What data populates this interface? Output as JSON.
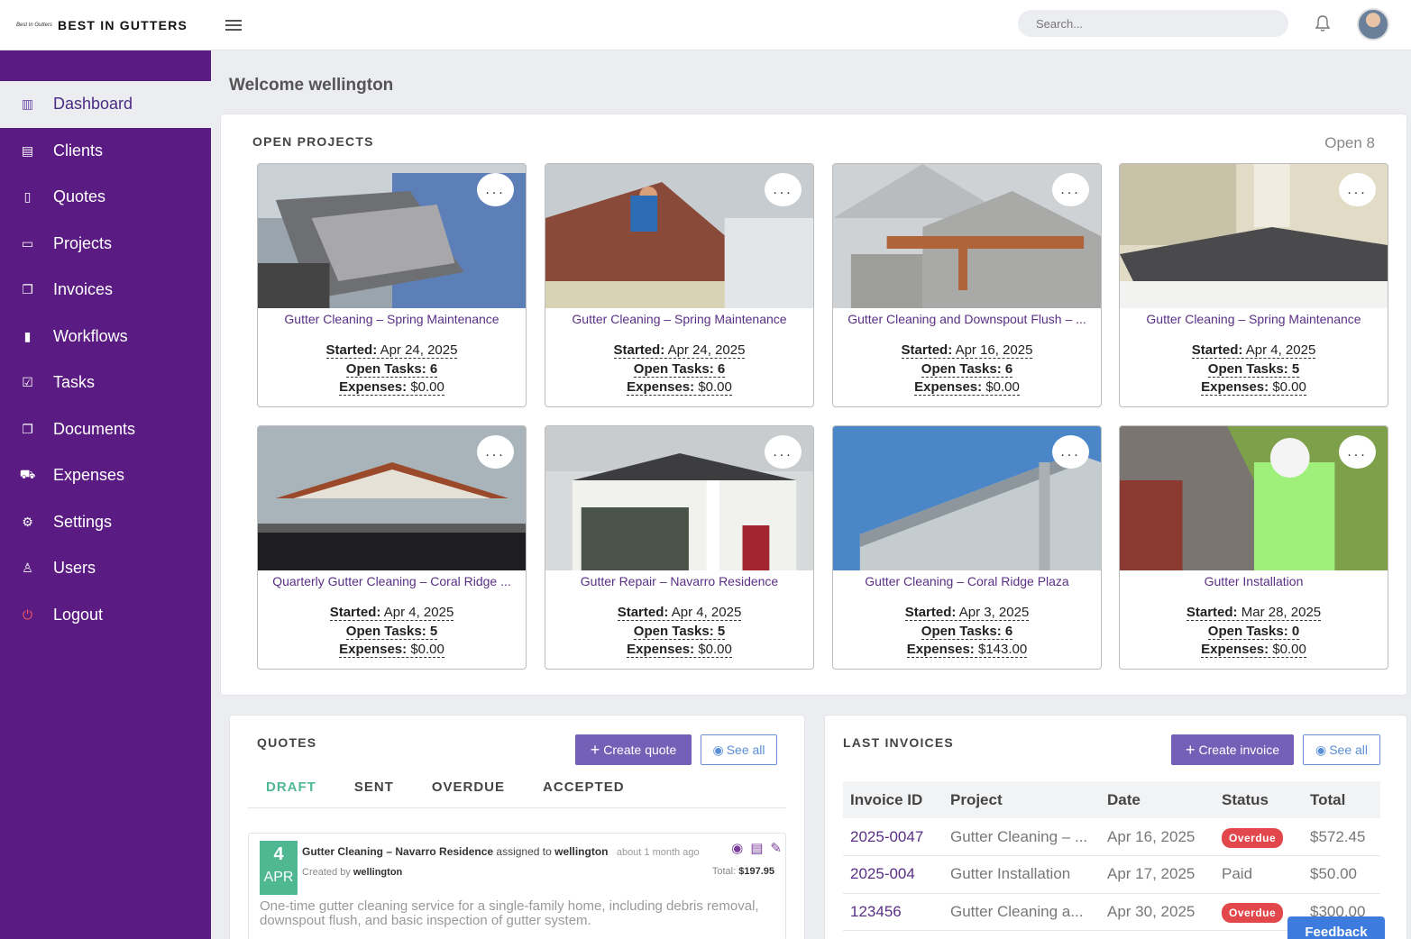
{
  "brand": {
    "logo_text": "Best In Gutters",
    "name": "BEST IN GUTTERS"
  },
  "search": {
    "placeholder": "Search..."
  },
  "sidebar": {
    "items": [
      {
        "label": "Dashboard",
        "icon": "bar-chart-icon"
      },
      {
        "label": "Clients",
        "icon": "id-card-icon"
      },
      {
        "label": "Quotes",
        "icon": "document-icon"
      },
      {
        "label": "Projects",
        "icon": "folder-icon"
      },
      {
        "label": "Invoices",
        "icon": "file-copy-icon"
      },
      {
        "label": "Workflows",
        "icon": "book-icon"
      },
      {
        "label": "Tasks",
        "icon": "checkbox-icon"
      },
      {
        "label": "Documents",
        "icon": "files-icon"
      },
      {
        "label": "Expenses",
        "icon": "cart-icon"
      },
      {
        "label": "Settings",
        "icon": "gear-icon"
      },
      {
        "label": "Users",
        "icon": "user-icon"
      },
      {
        "label": "Logout",
        "icon": "power-icon"
      }
    ]
  },
  "welcome": "Welcome wellington",
  "projects": {
    "title": "OPEN PROJECTS",
    "open_count": "Open 8",
    "more_label": "...",
    "started_label": "Started:",
    "tasks_label": "Open Tasks:",
    "expenses_label": "Expenses:",
    "cards": [
      {
        "title": "Gutter Cleaning – Spring Maintenance",
        "started": "Apr 24, 2025",
        "tasks": "6",
        "expenses": "$0.00"
      },
      {
        "title": "Gutter Cleaning – Spring Maintenance",
        "started": "Apr 24, 2025",
        "tasks": "6",
        "expenses": "$0.00"
      },
      {
        "title": "Gutter Cleaning and Downspout Flush – ...",
        "started": "Apr 16, 2025",
        "tasks": "6",
        "expenses": "$0.00"
      },
      {
        "title": "Gutter Cleaning – Spring Maintenance",
        "started": "Apr 4, 2025",
        "tasks": "5",
        "expenses": "$0.00"
      },
      {
        "title": "Quarterly Gutter Cleaning – Coral Ridge ...",
        "started": "Apr 4, 2025",
        "tasks": "5",
        "expenses": "$0.00"
      },
      {
        "title": "Gutter Repair – Navarro Residence",
        "started": "Apr 4, 2025",
        "tasks": "5",
        "expenses": "$0.00"
      },
      {
        "title": "Gutter Cleaning – Coral Ridge Plaza",
        "started": "Apr 3, 2025",
        "tasks": "6",
        "expenses": "$143.00"
      },
      {
        "title": "Gutter Installation",
        "started": "Mar 28, 2025",
        "tasks": "0",
        "expenses": "$0.00"
      }
    ]
  },
  "quotes": {
    "title": "QUOTES",
    "create_label": "Create quote",
    "see_all_label": "See all",
    "tabs": [
      "DRAFT",
      "SENT",
      "OVERDUE",
      "ACCEPTED"
    ],
    "item": {
      "day": "4",
      "month": "APR",
      "title": "Gutter Cleaning – Navarro Residence",
      "assigned_text": "assigned to",
      "assignee": "wellington",
      "ago": "about 1 month ago",
      "created_text": "Created by",
      "creator": "wellington",
      "total_label": "Total:",
      "total": "$197.95",
      "description": "One-time gutter cleaning service for a single-family home, including debris removal, downspout flush, and basic inspection of gutter system."
    }
  },
  "invoices": {
    "title": "LAST INVOICES",
    "create_label": "Create invoice",
    "see_all_label": "See all",
    "columns": [
      "Invoice ID",
      "Project",
      "Date",
      "Status",
      "Total"
    ],
    "rows": [
      {
        "id": "2025-0047",
        "project": "Gutter Cleaning – ...",
        "date": "Apr 16, 2025",
        "status": "Overdue",
        "total": "$572.45"
      },
      {
        "id": "2025-004",
        "project": "Gutter Installation",
        "date": "Apr 17, 2025",
        "status": "Paid",
        "total": "$50.00"
      },
      {
        "id": "123456",
        "project": "Gutter Cleaning a...",
        "date": "Apr 30, 2025",
        "status": "Overdue",
        "total": "$300.00"
      }
    ]
  },
  "feedback_label": "Feedback",
  "colors": {
    "sidebar": "#5a1b82",
    "accent": "#7460b6",
    "draft": "#4fb893",
    "overdue": "#e2474b",
    "link": "#5a2f86"
  }
}
